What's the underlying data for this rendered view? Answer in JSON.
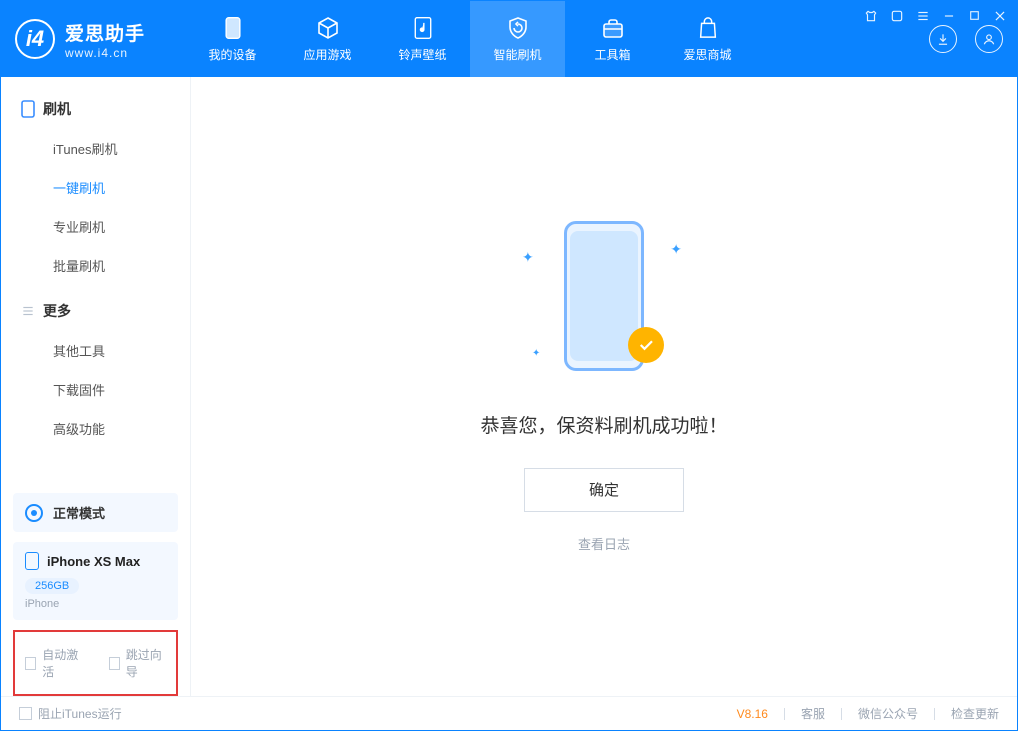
{
  "brand": {
    "name": "爱思助手",
    "url": "www.i4.cn"
  },
  "tabs": {
    "device": "我的设备",
    "apps": "应用游戏",
    "ringtone": "铃声壁纸",
    "flash": "智能刷机",
    "toolbox": "工具箱",
    "store": "爱思商城"
  },
  "sidebar": {
    "flash_header": "刷机",
    "items": {
      "itunes": "iTunes刷机",
      "onekey": "一键刷机",
      "pro": "专业刷机",
      "batch": "批量刷机"
    },
    "more_header": "更多",
    "more": {
      "other": "其他工具",
      "firmware": "下载固件",
      "advanced": "高级功能"
    },
    "mode_card": "正常模式",
    "device": {
      "name": "iPhone XS Max",
      "storage": "256GB",
      "type": "iPhone"
    },
    "options": {
      "auto_activate": "自动激活",
      "skip_guide": "跳过向导"
    }
  },
  "main": {
    "message": "恭喜您，保资料刷机成功啦！",
    "ok": "确定",
    "log": "查看日志"
  },
  "footer": {
    "block_itunes": "阻止iTunes运行",
    "version": "V8.16",
    "support": "客服",
    "wechat": "微信公众号",
    "update": "检查更新"
  }
}
